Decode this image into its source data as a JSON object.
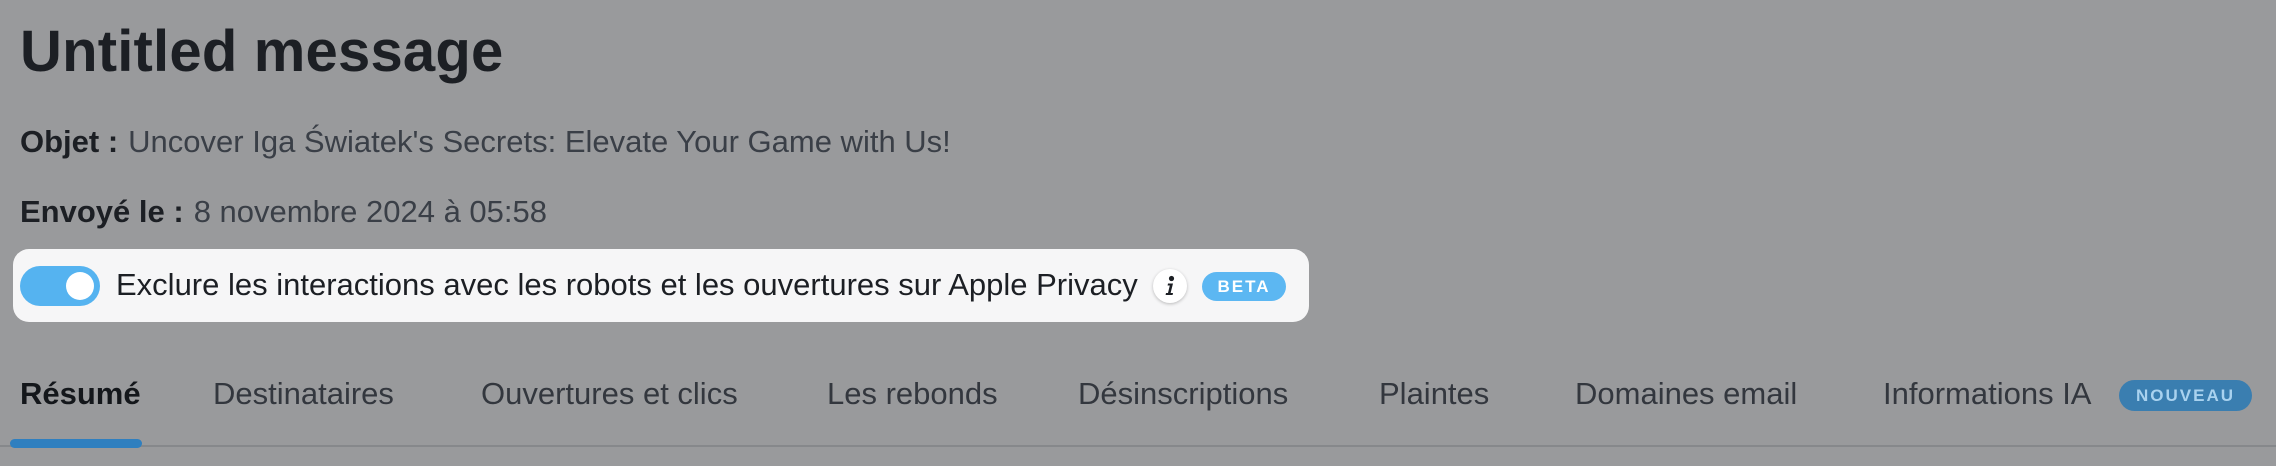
{
  "message": {
    "title": "Untitled message",
    "subject_label": "Objet :",
    "subject_value": "Uncover Iga Światek's Secrets: Elevate Your Game with Us!",
    "sent_label": "Envoyé le :",
    "sent_value": "8 novembre 2024 à 05:58"
  },
  "privacy_filter": {
    "enabled": true,
    "label": "Exclure les interactions avec les robots et les ouvertures sur Apple Privacy",
    "info_icon": "info-icon",
    "badge": "BETA"
  },
  "tabs": {
    "active": "Résumé",
    "items": [
      {
        "label": "Résumé"
      },
      {
        "label": "Destinataires"
      },
      {
        "label": "Ouvertures et clics"
      },
      {
        "label": "Les rebonds"
      },
      {
        "label": "Désinscriptions"
      },
      {
        "label": "Plaintes"
      },
      {
        "label": "Domaines email"
      },
      {
        "label": "Informations IA",
        "badge": "NOUVEAU"
      }
    ]
  },
  "colors": {
    "overlay_background": "#999a9c",
    "toggle_on": "#55b3f0",
    "beta_badge": "#5cb7f2",
    "active_tab_indicator": "#2f7fbf",
    "nouveau_badge": "#3a7eb0"
  }
}
